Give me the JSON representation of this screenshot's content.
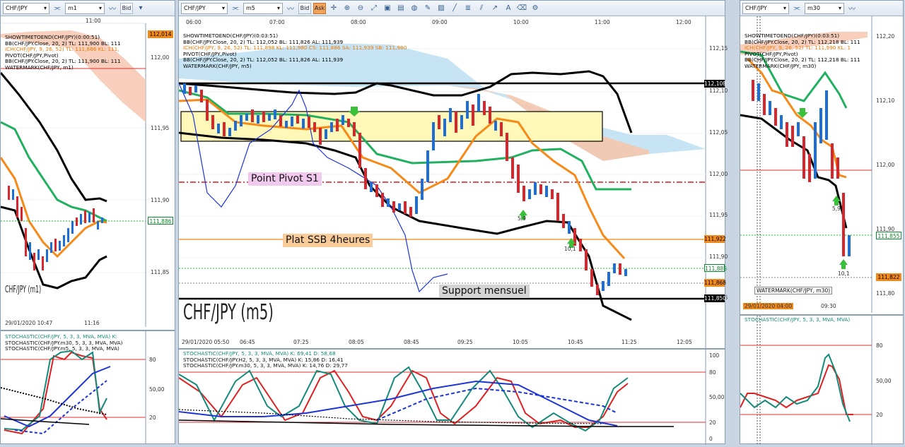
{
  "toolbars": {
    "left": {
      "symbol": "CHF/JPY",
      "period": "m1",
      "price_mode": "Bid"
    },
    "middle": {
      "symbol": "CHF/JPY",
      "period": "m5",
      "bid": "Bid",
      "ask": "Ask"
    },
    "right": {
      "symbol": "CHF/JPY",
      "period": "m30"
    }
  },
  "left_chart": {
    "time_top": "11:00",
    "legend": [
      "SHOWTIMETOEND(CHF/JPY)(0:00:51)",
      "BB(CHF/JPY.Close, 20, 2)  TL: 111,900  BL: 111",
      "ICH(CHF/JPY, 9, 26, 52)  TL: 111,886  KL: 111,",
      "PIVOT(CHF/JPY,Pivot)",
      "BB(CHF/JPY.Close, 20, 2)  TL: 111,900  BL: 111",
      "WATERMARK(CHF/JPY, m1)"
    ],
    "yaxis": [
      "112,00",
      "111,95",
      "111,90",
      "111,85"
    ],
    "tag_top": "112,014",
    "tag_price": "111,886",
    "watermark": "CHF/JPY (m1)",
    "time_bottom": [
      "29/01/2020 10:47",
      "11:16"
    ],
    "stoch_legend": [
      "STOCHASTIC(CHF/JPY, 5, 3, 3, MVA, MVA)   K:",
      "STOCHASTIC(CHF/JPY.m30, 5, 3, 3, MVA, MVA)",
      "STOCHASTIC(CHF/JPY.m5, 5, 3, 3, MVA, MVA)"
    ],
    "stoch_y": [
      "80",
      "50,00",
      "20"
    ]
  },
  "middle_chart": {
    "time_top": [
      "06:00",
      "07:00",
      "08:00",
      "09:00",
      "10:00",
      "11:00",
      "12:00"
    ],
    "legend": [
      "SHOWTIMETOEND(CHF/JPY)(0:03:51)",
      "BB(CHF/JPY.Close, 20, 2)  TL: 112,052  BL: 111,826  AL: 111,939",
      "ICH(CHF/JPY, 9, 26, 52)  TL: 111,898  KL: 111,980  CS: 111,886  SA: 111,939  SB: 111,980",
      "PIVOT(CHF/JPY,Pivot)",
      "BB(CHF/JPY.Close, 20, 2)  TL: 112,052  BL: 111,826  AL: 111,939",
      "WATERMARK(CHF/JPY, m5)"
    ],
    "yaxis": [
      "112,15",
      "112,10",
      "112,05",
      "112,00",
      "111,95",
      "111,90",
      "111,85"
    ],
    "tags": {
      "resistance": "112,108",
      "ssb": "111,922",
      "green": "111,886",
      "current": "111,868",
      "support": "111,850"
    },
    "labels": {
      "pivot": "Point Pivot S1",
      "ssb": "Plat SSB 4heures",
      "support": "Support mensuel"
    },
    "arrow_labels": [
      "5,9",
      "10,1"
    ],
    "watermark": "CHF/JPY (m5)",
    "time_bottom": [
      "29/01/2020 05:50",
      "06:45",
      "07:25",
      "08:05",
      "08:45",
      "09:25",
      "10:05",
      "10:45",
      "11:25",
      "12:05"
    ],
    "stoch_legend": [
      "STOCHASTIC(CHF/JPY, 5, 3, 3, MVA, MVA)   K: 69,41   D: 58,68",
      "STOCHASTIC(CHF/JPY.H2, 5, 3, 3, MVA, MVA)   K: 15,86   D: 16,41",
      "STOCHASTIC(CHF/JPY.m30, 5, 3, 3, MVA, MVA)   K: 14,76   D: 29,77"
    ],
    "stoch_y": [
      "100",
      "80",
      "50,00",
      "20",
      "0"
    ]
  },
  "right_chart": {
    "legend": [
      "SHOWTIMETOEND(CHF/JPY)(0:03:51)",
      "BB(CHF/JPY.Close, 20, 2)  TL: 112,218  BL: 111",
      "ICH(CHF/JPY, 9, 26, 52)  TL: 111,990  KL: 1",
      "PIVOT(CHF/JPY,Pivot)",
      "BB(CHF/JPY.Close, 20, 2)  TL: 112,218  BL: 111",
      "WATERMARK(CHF/JPY, m30)"
    ],
    "yaxis": [
      "112,20",
      "112,10",
      "112,00",
      "111,90",
      "111,80"
    ],
    "tags": {
      "green": "111,855",
      "orange": "111,822"
    },
    "arrow_labels": [
      "5,9",
      "10,1"
    ],
    "watermark_tip": "WATERMARK(CHF/JPY, m30)",
    "time_bottom": [
      "29/01/2020 04:00",
      "09:30"
    ],
    "stoch_legend": [
      "STOCHASTIC(CHF/JPY, 5, 3, 3, MVA, MVA)"
    ],
    "stoch_y": [
      "80",
      "50,00",
      "20"
    ]
  }
}
